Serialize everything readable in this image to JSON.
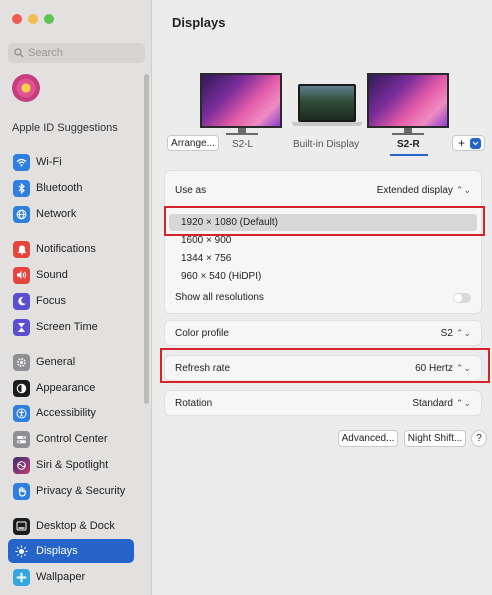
{
  "sidebar": {
    "search_placeholder": "Search",
    "apple_id": "Apple ID Suggestions",
    "items": [
      {
        "label": "Wi-Fi",
        "icon": "wifi-icon",
        "color": "#2f7fe0"
      },
      {
        "label": "Bluetooth",
        "icon": "bluetooth-icon",
        "color": "#2f7fe0"
      },
      {
        "label": "Network",
        "icon": "globe-icon",
        "color": "#2f7fe0"
      },
      {
        "label": "Notifications",
        "icon": "bell-icon",
        "color": "#e5453c"
      },
      {
        "label": "Sound",
        "icon": "speaker-icon",
        "color": "#e5453c"
      },
      {
        "label": "Focus",
        "icon": "moon-icon",
        "color": "#5b4fd1"
      },
      {
        "label": "Screen Time",
        "icon": "hourglass-icon",
        "color": "#5b4fd1"
      },
      {
        "label": "General",
        "icon": "gear-icon",
        "color": "#8e8e93"
      },
      {
        "label": "Appearance",
        "icon": "appearance-icon",
        "color": "#1c1c1e"
      },
      {
        "label": "Accessibility",
        "icon": "accessibility-icon",
        "color": "#2f7fe0"
      },
      {
        "label": "Control Center",
        "icon": "control-center-icon",
        "color": "#8e8e93"
      },
      {
        "label": "Siri & Spotlight",
        "icon": "siri-icon",
        "color": "#3a2f6b"
      },
      {
        "label": "Privacy & Security",
        "icon": "hand-icon",
        "color": "#2f7fe0"
      },
      {
        "label": "Desktop & Dock",
        "icon": "dock-icon",
        "color": "#1c1c1e"
      },
      {
        "label": "Displays",
        "icon": "sun-icon",
        "color": "#2f7fe0"
      },
      {
        "label": "Wallpaper",
        "icon": "wallpaper-icon",
        "color": "#35a7e0"
      }
    ]
  },
  "main": {
    "title": "Displays",
    "arrange_label": "Arrange...",
    "displays": [
      "S2-L",
      "Built-in Display",
      "S2-R"
    ],
    "add_label": "+",
    "use_as": {
      "label": "Use as",
      "value": "Extended display"
    },
    "resolutions": [
      "1920 × 1080 (Default)",
      "1600 × 900",
      "1344 × 756",
      "960 × 540 (HiDPI)"
    ],
    "show_all": "Show all resolutions",
    "color_profile": {
      "label": "Color profile",
      "value": "S2"
    },
    "refresh_rate": {
      "label": "Refresh rate",
      "value": "60 Hertz"
    },
    "rotation": {
      "label": "Rotation",
      "value": "Standard"
    },
    "advanced_label": "Advanced...",
    "night_shift_label": "Night Shift...",
    "help_label": "?"
  },
  "colors": {
    "accent": "#2764c9",
    "highlight": "#d6232a"
  }
}
